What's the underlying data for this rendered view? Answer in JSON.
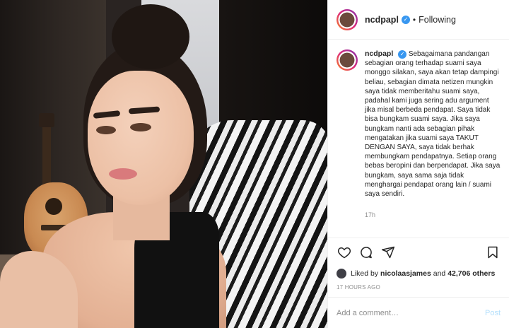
{
  "header": {
    "username": "ncdpapl",
    "follow_status": "Following",
    "separator": "•"
  },
  "caption": {
    "username": "ncdpapl",
    "text": "Sebagaimana pandangan sebagian orang terhadap suami saya monggo silakan, saya akan tetap dampingi beliau, sebagian dimata netizen mungkin saya tidak memberitahu suami saya, padahal kami juga sering adu argument jika misal berbeda pendapat. Saya tidak bisa bungkam suami saya. Jika saya bungkam nanti ada sebagian pihak mengatakan jika suami saya TAKUT DENGAN SAYA, saya tidak berhak membungkam pendapatnya. Setiap orang bebas beropini dan berpendapat. Jika saya bungkam, saya sama saja tidak menghargai pendapat orang lain / suami saya sendiri.",
    "time": "17h"
  },
  "actions": {
    "icons": [
      "heart-icon",
      "comment-icon",
      "share-icon",
      "bookmark-icon"
    ]
  },
  "likes": {
    "prefix": "Liked by",
    "user": "nicolaasjames",
    "and": "and",
    "count": "42,706 others"
  },
  "age": "17 HOURS AGO",
  "comment": {
    "placeholder": "Add a comment…",
    "post_label": "Post"
  },
  "colors": {
    "verified": "#3897f0",
    "post_disabled": "#b2dffc",
    "muted": "#8e8e8e"
  }
}
